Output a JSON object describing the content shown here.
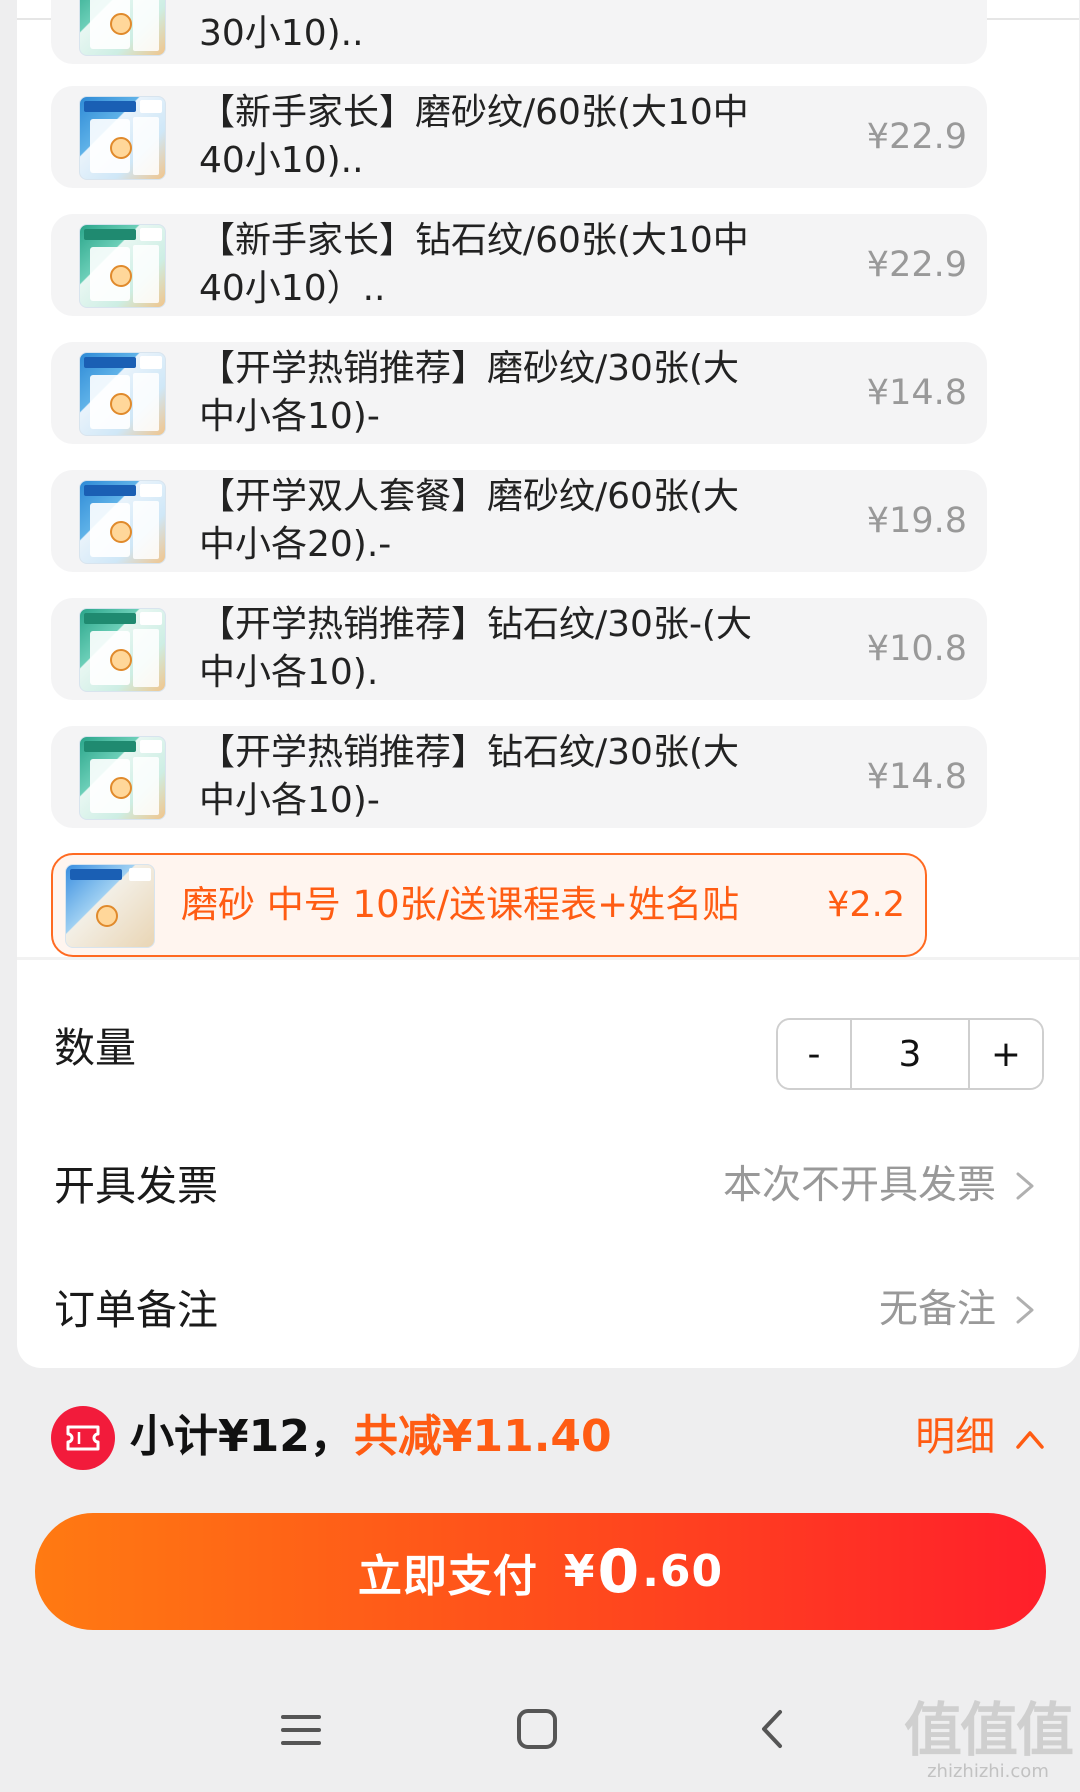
{
  "items": [
    {
      "title": "30小10)..",
      "price": "",
      "variant": "green"
    },
    {
      "title": "【新手家长】磨砂纹/60张(大10中\n40小10)..",
      "price": "¥22.9",
      "variant": "blue"
    },
    {
      "title": "【新手家长】钻石纹/60张(大10中\n40小10）..",
      "price": "¥22.9",
      "variant": "green"
    },
    {
      "title": "【开学热销推荐】磨砂纹/30张(大\n中小各10)-",
      "price": "¥14.8",
      "variant": "blue"
    },
    {
      "title": "【开学双人套餐】磨砂纹/60张(大\n中小各20).-",
      "price": "¥19.8",
      "variant": "blue"
    },
    {
      "title": "【开学热销推荐】钻石纹/30张-(大\n中小各10).",
      "price": "¥10.8",
      "variant": "green"
    },
    {
      "title": "【开学热销推荐】钻石纹/30张(大\n中小各10)-",
      "price": "¥14.8",
      "variant": "green"
    }
  ],
  "selected_item": {
    "title": "磨砂 中号 10张/送课程表+姓名贴",
    "price": "¥2.2"
  },
  "quantity": {
    "label": "数量",
    "minus": "-",
    "value": "3",
    "plus": "+"
  },
  "invoice": {
    "label": "开具发票",
    "value": "本次不开具发票"
  },
  "remark": {
    "label": "订单备注",
    "value": "无备注"
  },
  "summary": {
    "subtotal": "小计¥12，",
    "discount": "共减¥11.40",
    "detail": "明细"
  },
  "pay": {
    "label": "立即支付",
    "currency": "¥",
    "amount_int": "0",
    "amount_dec": ".60"
  },
  "watermark": {
    "mark": "值值值",
    "url": "zhizhizhi.com"
  },
  "colors": {
    "accent": "#ff5c13",
    "pay_start": "#ff7a12",
    "pay_end": "#ff1f2b",
    "coupon": "#f21b3b"
  },
  "icons": {
    "chevron": "chevron-right-icon",
    "detail": "chevron-up-icon",
    "coupon": "ticket-icon"
  }
}
